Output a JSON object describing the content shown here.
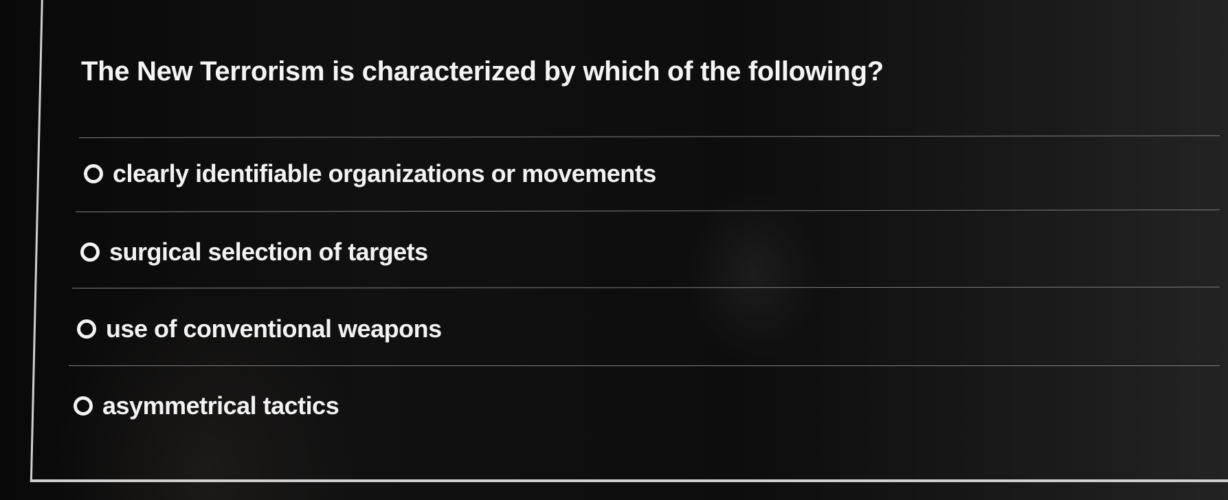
{
  "quiz": {
    "question": "The New Terrorism is characterized by which of the following?",
    "options": [
      {
        "label": "clearly identifiable organizations or movements",
        "selected": false
      },
      {
        "label": "surgical selection of targets",
        "selected": false
      },
      {
        "label": "use of conventional weapons",
        "selected": false
      },
      {
        "label": "asymmetrical tactics",
        "selected": false
      }
    ]
  }
}
